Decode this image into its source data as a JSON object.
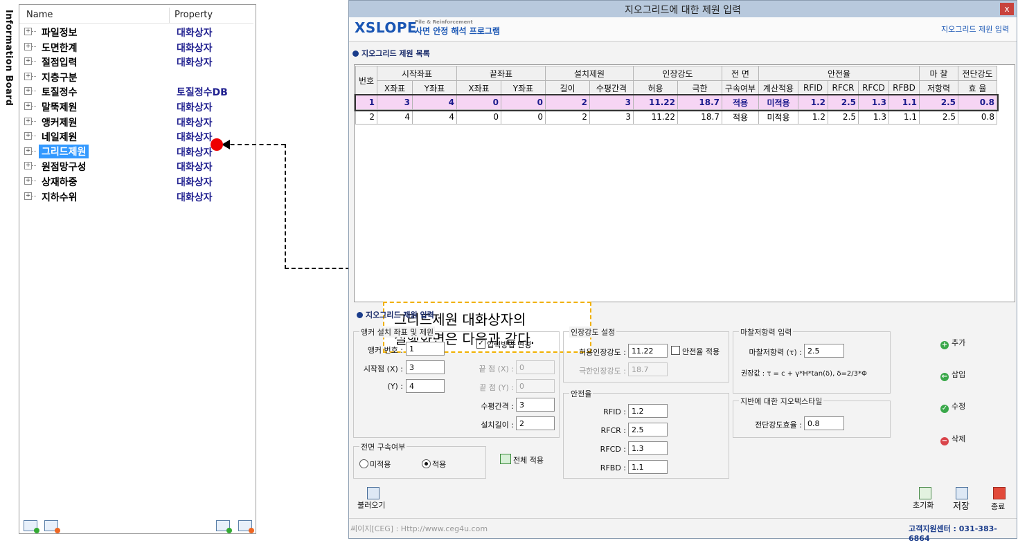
{
  "info_board": {
    "label": "Information Board"
  },
  "tree": {
    "col_name": "Name",
    "col_property": "Property",
    "items": [
      {
        "name": "파일정보",
        "prop": "대화상자"
      },
      {
        "name": "도면한계",
        "prop": "대화상자"
      },
      {
        "name": "절점입력",
        "prop": "대화상자"
      },
      {
        "name": "지층구분",
        "prop": ""
      },
      {
        "name": "토질정수",
        "prop": "토질정수DB"
      },
      {
        "name": "말뚝제원",
        "prop": "대화상자"
      },
      {
        "name": "앵커제원",
        "prop": "대화상자"
      },
      {
        "name": "네일제원",
        "prop": "대화상자"
      },
      {
        "name": "그리드제원",
        "prop": "대화상자"
      },
      {
        "name": "원점망구성",
        "prop": "대화상자"
      },
      {
        "name": "상재하중",
        "prop": "대화상자"
      },
      {
        "name": "지하수위",
        "prop": "대화상자"
      }
    ]
  },
  "window": {
    "title": "지오그리드에 대한 제원 입력",
    "close": "x",
    "logo": "XSLOPE",
    "logo_sub": "Pile & Reinforcement",
    "logo_kor": "사면 안정 해석 프로그램",
    "header_right": "지오그리드 제원 입력"
  },
  "list_section": {
    "title": "지오그리드 제원 목록"
  },
  "grid": {
    "header1": [
      "번호",
      "시작좌표",
      "끝좌표",
      "설치제원",
      "인장강도",
      "전 면",
      "안전율",
      "마 찰",
      "전단강도"
    ],
    "header2": [
      "X좌표",
      "Y좌표",
      "X좌표",
      "Y좌표",
      "길이",
      "수평간격",
      "허용",
      "극한",
      "구속여부",
      "계산적용",
      "RFID",
      "RFCR",
      "RFCD",
      "RFBD",
      "저항력",
      "효 율"
    ],
    "rows": [
      [
        "1",
        "3",
        "4",
        "0",
        "0",
        "2",
        "3",
        "11.22",
        "18.7",
        "적용",
        "미적용",
        "1.2",
        "2.5",
        "1.3",
        "1.1",
        "2.5",
        "0.8"
      ],
      [
        "2",
        "4",
        "4",
        "0",
        "0",
        "2",
        "3",
        "11.22",
        "18.7",
        "적용",
        "미적용",
        "1.2",
        "2.5",
        "1.3",
        "1.1",
        "2.5",
        "0.8"
      ]
    ]
  },
  "callout": {
    "line1": "그리드제원 대화상자의",
    "line2": "실행화면은 다음과 같다."
  },
  "input_section": {
    "title": "지오그리드 제원 입력"
  },
  "anchor_group": {
    "legend": "앵커 설치 좌표 및 제원",
    "anchor_no_label": "앵커 번호 :",
    "anchor_no": "1",
    "start_x_label": "시작점 (X) :",
    "start_x": "3",
    "start_y_label": "(Y) :",
    "start_y": "4",
    "change_label": "입력방법 변경",
    "end_x_label": "끝 점 (X) :",
    "end_x": "0",
    "end_y_label": "끝 점 (Y) :",
    "end_y": "0",
    "spacing_label": "수평간격 :",
    "spacing": "3",
    "length_label": "설치길이 :",
    "length": "2"
  },
  "front_group": {
    "legend": "전면 구속여부",
    "opt1": "미적용",
    "opt2": "적용",
    "apply_all": "전체 적용"
  },
  "tensile_group": {
    "legend": "인장강도 설정",
    "allow_label": "허용인장강도 :",
    "allow": "11.22",
    "safety_check": "안전율 적용",
    "ultimate_label": "극한인장강도 :",
    "ultimate": "18.7"
  },
  "safety_group": {
    "legend": "안전율",
    "rfid_label": "RFID :",
    "rfid": "1.2",
    "rfcr_label": "RFCR :",
    "rfcr": "2.5",
    "rfcd_label": "RFCD :",
    "rfcd": "1.3",
    "rfbd_label": "RFBD :",
    "rfbd": "1.1"
  },
  "friction_group": {
    "legend": "마찰저항력 입력",
    "tau_label": "마찰저항력 (τ) :",
    "tau": "2.5",
    "recommend": "권장값 : τ = c + γ*H*tan(δ), δ=2/3*Φ"
  },
  "geotextile_group": {
    "legend": "지반에 대한 지오텍스타일",
    "eff_label": "전단강도효율 :",
    "eff": "0.8"
  },
  "side_buttons": {
    "add": "추가",
    "insert": "삽입",
    "modify": "수정",
    "delete": "삭제"
  },
  "bottom": {
    "load": "불러오기",
    "reset": "초기화",
    "save": "저장",
    "exit": "종료"
  },
  "footer": {
    "left": "씨이지[CEG] : Http://www.ceg4u.com",
    "right": "고객지원센터 : 031-383-6864"
  }
}
